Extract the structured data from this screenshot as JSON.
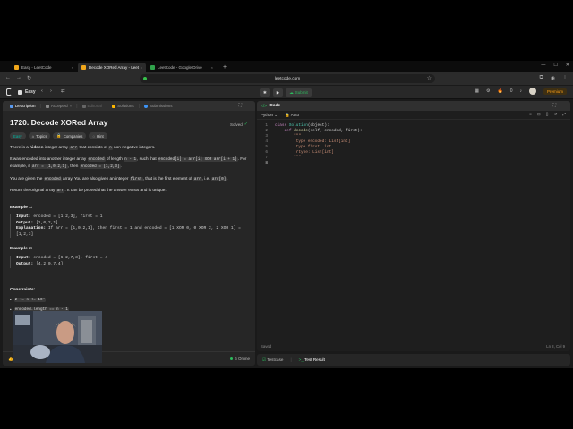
{
  "browser": {
    "tabs": [
      {
        "title": "Easy - LeetCode",
        "active": false,
        "icon": "leetcode-favicon"
      },
      {
        "title": "Decode XORed Array - Leet",
        "active": true,
        "icon": "leetcode-favicon"
      },
      {
        "title": "LeetCode - Google Drive",
        "active": false,
        "icon": "google-drive-favicon"
      }
    ],
    "new_tab": "+",
    "url": "leetcode.com"
  },
  "navbar": {
    "list_label": "Easy",
    "run": "▶",
    "submit": "Submit",
    "notifications_count": "0",
    "premium": "Premium"
  },
  "left_tabs": [
    {
      "label": "Description",
      "active": true,
      "icon": "description-icon"
    },
    {
      "label": "Accepted",
      "active": false,
      "icon": "accepted-icon"
    },
    {
      "label": "Editorial",
      "active": false,
      "icon": "editorial-icon"
    },
    {
      "label": "Solutions",
      "active": false,
      "icon": "solutions-icon"
    },
    {
      "label": "Submissions",
      "active": false,
      "icon": "submissions-icon"
    }
  ],
  "problem": {
    "title": "1720. Decode XORed Array",
    "status": "Solved",
    "badges": [
      "Easy",
      "Topics",
      "Companies",
      "Hint"
    ],
    "p1": {
      "t1": "There is a ",
      "b1": "hidden",
      "t2": " integer array ",
      "c1": "arr",
      "t3": " that consists of ",
      "c2": "n",
      "t4": " non-negative integers."
    },
    "p2": {
      "t1": "It was encoded into another integer array ",
      "c1": "encoded",
      "t2": " of length ",
      "c2": "n - 1",
      "t3": ", such that ",
      "c3": "encoded[i] = arr[i] XOR arr[i + 1]",
      "t4": ". For example, if ",
      "c4": "arr = [1,0,2,1]",
      "t5": ", then ",
      "c5": "encoded = [1,2,3]",
      "t6": "."
    },
    "p3": {
      "t1": "You are given the ",
      "c1": "encoded",
      "t2": " array. You are also given an integer ",
      "c2": "first",
      "t3": ", that is the first element of ",
      "c3": "arr",
      "t4": ", i.e. ",
      "c4": "arr[0]",
      "t5": "."
    },
    "p4": {
      "t1": "Return the original array ",
      "c1": "arr",
      "t2": ". It can be proved that the answer exists and is unique."
    },
    "example1": {
      "title": "Example 1:",
      "input_label": "Input:",
      "input": "encoded = [1,2,3], first = 1",
      "output_label": "Output:",
      "output": "[1,0,2,1]",
      "expl_label": "Explanation:",
      "expl": "If arr = [1,0,2,1], then first = 1 and encoded = [1 XOR 0, 0 XOR 2, 2 XOR 1] = [1,2,3]"
    },
    "example2": {
      "title": "Example 2:",
      "input_label": "Input:",
      "input": "encoded = [6,2,7,3], first = 4",
      "output_label": "Output:",
      "output": "[4,2,0,7,4]"
    },
    "constraints_title": "Constraints:",
    "constraints": [
      "2 <= n <= 10⁴",
      "encoded.length == n - 1"
    ]
  },
  "left_footer": {
    "likes": "1.6K",
    "comments": "26",
    "online": "6 Online"
  },
  "editor": {
    "title": "Code",
    "language": "Python",
    "mode": "Auto",
    "status": "Saved",
    "cursor": "Ln 8, Col 9",
    "line_numbers": [
      "1",
      "2",
      "3",
      "4",
      "5",
      "6",
      "7",
      "8"
    ],
    "code": {
      "l1_kw": "class ",
      "l1_cls": "Solution",
      "l1_rest": "(object):",
      "l2_indent": "    ",
      "l2_kw": "def ",
      "l2_fn": "decode",
      "l2_rest": "(self, encoded, first):",
      "l3": "        \"\"\"",
      "l4": "        :type encoded: List[int]",
      "l5": "        :type first: int",
      "l6": "        :rtype: List[int]",
      "l7": "        \"\"\"",
      "l8": "        "
    }
  },
  "test_panel": {
    "testcase": "Testcase",
    "result": "Test Result"
  }
}
